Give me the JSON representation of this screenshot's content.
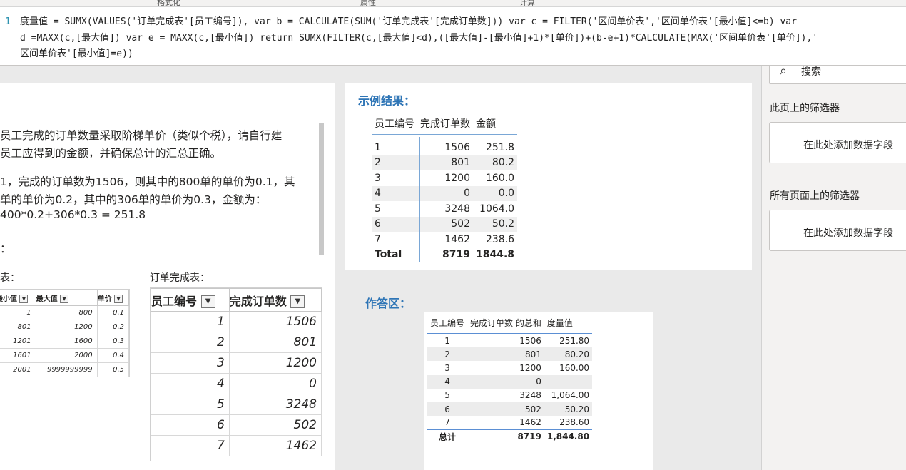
{
  "top_tabs": [
    "格式化",
    "属性",
    "计算"
  ],
  "formula": {
    "line_number": "1",
    "lines": [
      "度量值 = SUMX(VALUES('订单完成表'[员工编号]), var b = CALCULATE(SUM('订单完成表'[完成订单数])) var c = FILTER('区间单价表','区间单价表'[最小值]<=b) var",
      "d =MAXX(c,[最大值]) var e = MAXX(c,[最小值]) return SUMX(FILTER(c,[最大值]<d),([最大值]-[最小值]+1)*[单价])+(b-e+1)*CALCULATE(MAX('区间单价表'[单价]),'",
      "区间单价表'[最小值]=e))"
    ]
  },
  "description": {
    "lines": [
      "员工完成的订单数量采取阶梯单价（类似个税），请自行建",
      "员工应得到的金额，并确保总计的汇总正确。",
      "1，完成的订单数为1506，则其中的800单的单价为0.1，其",
      "单的单价为0.2，其中的306单的单价为0.3，金额为：",
      "400*0.2+306*0.3 = 251.8",
      "："
    ],
    "price_table_label": "表：",
    "order_table_label": "订单完成表："
  },
  "price_table": {
    "headers": [
      "最小值",
      "最大值",
      "单价"
    ],
    "rows": [
      [
        "1",
        "800",
        "0.1"
      ],
      [
        "801",
        "1200",
        "0.2"
      ],
      [
        "1201",
        "1600",
        "0.3"
      ],
      [
        "1601",
        "2000",
        "0.4"
      ],
      [
        "2001",
        "9999999999",
        "0.5"
      ]
    ]
  },
  "order_table": {
    "headers": [
      "员工编号",
      "完成订单数"
    ],
    "rows": [
      [
        "1",
        "1506"
      ],
      [
        "2",
        "801"
      ],
      [
        "3",
        "1200"
      ],
      [
        "4",
        "0"
      ],
      [
        "5",
        "3248"
      ],
      [
        "6",
        "502"
      ],
      [
        "7",
        "1462"
      ]
    ]
  },
  "example": {
    "heading": "示例结果：",
    "headers": [
      "员工编号",
      "完成订单数",
      "金额"
    ],
    "rows": [
      [
        "1",
        "1506",
        "251.8"
      ],
      [
        "2",
        "801",
        "80.2"
      ],
      [
        "3",
        "1200",
        "160.0"
      ],
      [
        "4",
        "0",
        "0.0"
      ],
      [
        "5",
        "3248",
        "1064.0"
      ],
      [
        "6",
        "502",
        "50.2"
      ],
      [
        "7",
        "1462",
        "238.6"
      ]
    ],
    "total": [
      "Total",
      "8719",
      "1844.8"
    ]
  },
  "answer": {
    "heading": "作答区：",
    "headers": [
      "员工编号",
      "完成订单数 的总和",
      "度量值"
    ],
    "rows": [
      [
        "1",
        "1506",
        "251.80"
      ],
      [
        "2",
        "801",
        "80.20"
      ],
      [
        "3",
        "1200",
        "160.00"
      ],
      [
        "4",
        "0",
        ""
      ],
      [
        "5",
        "3248",
        "1,064.00"
      ],
      [
        "6",
        "502",
        "50.20"
      ],
      [
        "7",
        "1462",
        "238.60"
      ]
    ],
    "total": [
      "总计",
      "8719",
      "1,844.80"
    ]
  },
  "filters": {
    "search_placeholder": "搜索",
    "this_page_label": "此页上的筛选器",
    "this_page_drop": "在此处添加数据字段",
    "all_pages_label": "所有页面上的筛选器",
    "all_pages_drop": "在此处添加数据字段"
  }
}
